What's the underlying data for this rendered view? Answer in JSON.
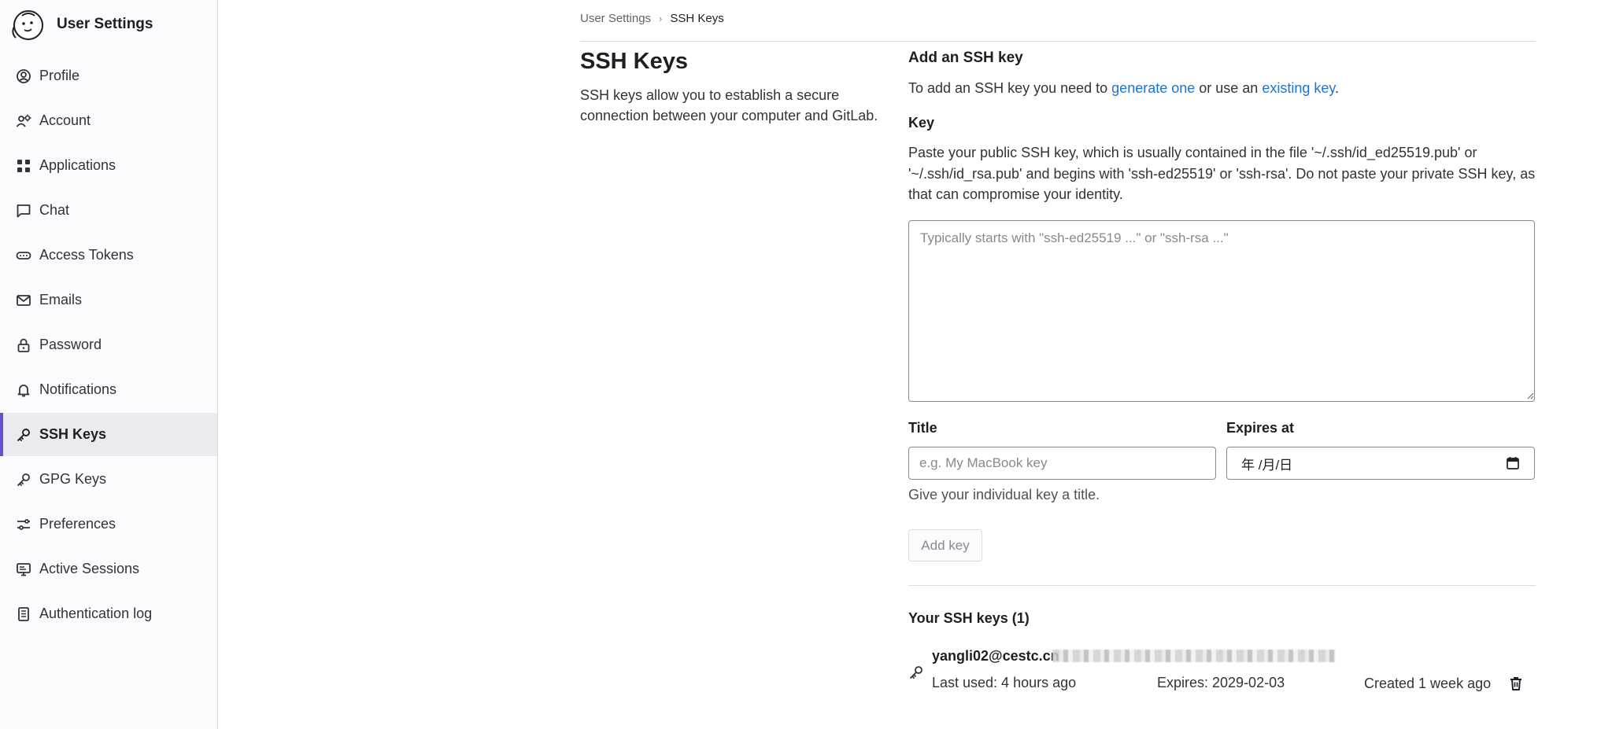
{
  "sidebar": {
    "title": "User Settings",
    "items": [
      {
        "label": "Profile",
        "icon": "profile-icon",
        "active": false
      },
      {
        "label": "Account",
        "icon": "account-icon",
        "active": false
      },
      {
        "label": "Applications",
        "icon": "applications-icon",
        "active": false
      },
      {
        "label": "Chat",
        "icon": "chat-icon",
        "active": false
      },
      {
        "label": "Access Tokens",
        "icon": "token-icon",
        "active": false
      },
      {
        "label": "Emails",
        "icon": "mail-icon",
        "active": false
      },
      {
        "label": "Password",
        "icon": "lock-icon",
        "active": false
      },
      {
        "label": "Notifications",
        "icon": "bell-icon",
        "active": false
      },
      {
        "label": "SSH Keys",
        "icon": "key-icon",
        "active": true
      },
      {
        "label": "GPG Keys",
        "icon": "key-icon",
        "active": false
      },
      {
        "label": "Preferences",
        "icon": "preferences-icon",
        "active": false
      },
      {
        "label": "Active Sessions",
        "icon": "monitor-icon",
        "active": false
      },
      {
        "label": "Authentication log",
        "icon": "log-icon",
        "active": false
      }
    ]
  },
  "breadcrumb": {
    "parent": "User Settings",
    "separator": "›",
    "current": "SSH Keys"
  },
  "page": {
    "title": "SSH Keys",
    "description": "SSH keys allow you to establish a secure connection between your computer and GitLab."
  },
  "add_form": {
    "heading": "Add an SSH key",
    "intro_before": "To add an SSH key you need to ",
    "link_generate": "generate one",
    "intro_middle": " or use an ",
    "link_existing": "existing key",
    "intro_after": ".",
    "key_label": "Key",
    "key_help": "Paste your public SSH key, which is usually contained in the file '~/.ssh/id_ed25519.pub' or '~/.ssh/id_rsa.pub' and begins with 'ssh-ed25519' or 'ssh-rsa'. Do not paste your private SSH key, as that can compromise your identity.",
    "key_placeholder": "Typically starts with \"ssh-ed25519 ...\" or \"ssh-rsa ...\"",
    "key_value": "",
    "title_label": "Title",
    "title_placeholder": "e.g. My MacBook key",
    "title_value": "",
    "expires_label": "Expires at",
    "expires_value": "年 /月/日",
    "title_help": "Give your individual key a title.",
    "submit_label": "Add key",
    "submit_disabled": true
  },
  "keys_list": {
    "heading": "Your SSH keys (1)",
    "items": [
      {
        "title": "yangli02@cestc.cn",
        "last_used": "Last used: 4 hours ago",
        "expires": "Expires: 2029-02-03",
        "created": "Created 1 week ago"
      }
    ]
  },
  "colors": {
    "accent": "#6053c7",
    "link": "#1f75cb",
    "sidebar_bg": "#fbfafd",
    "active_bg": "#ebeaf0",
    "border": "#dcdcde"
  }
}
